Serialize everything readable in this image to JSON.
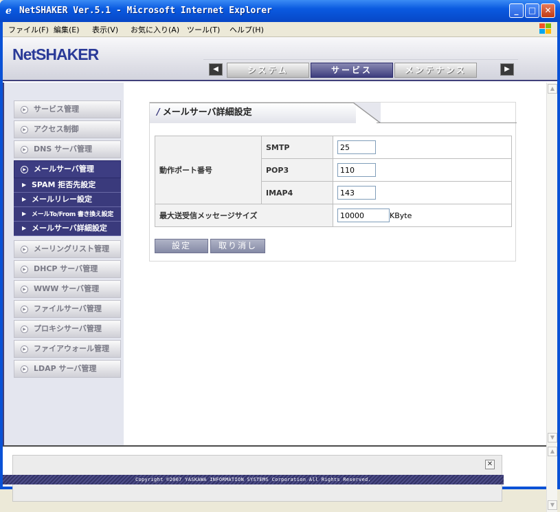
{
  "window": {
    "title": "NetSHAKER Ver.5.1 - Microsoft Internet Explorer"
  },
  "menubar": [
    "ファイル(F)",
    "編集(E)",
    "表示(V)",
    "お気に入り(A)",
    "ツール(T)",
    "ヘルプ(H)"
  ],
  "header": {
    "logo": "NetSHAKER",
    "tabs": [
      {
        "label": "システム",
        "active": false
      },
      {
        "label": "サービス",
        "active": true
      },
      {
        "label": "メンテナンス",
        "active": false
      }
    ]
  },
  "sidebar": {
    "items_top": [
      "サービス管理",
      "アクセス制御",
      "DNS サーバ管理"
    ],
    "active_item": "メールサーバ管理",
    "sub_items": [
      "SPAM 拒否先設定",
      "メールリレー設定",
      "メールTo/From 書き換え設定",
      "メールサーバ詳細設定"
    ],
    "items_bottom": [
      "メーリングリスト管理",
      "DHCP サーバ管理",
      "WWW サーバ管理",
      "ファイルサーバ管理",
      "プロキシサーバ管理",
      "ファイアウォール管理",
      "LDAP サーバ管理"
    ]
  },
  "panel": {
    "title": "メールサーバ詳細設定",
    "port_label": "動作ポート番号",
    "rows": [
      {
        "protocol": "SMTP",
        "value": "25"
      },
      {
        "protocol": "POP3",
        "value": "110"
      },
      {
        "protocol": "IMAP4",
        "value": "143"
      }
    ],
    "max_size_label": "最大送受信メッセージサイズ",
    "max_size_value": "10000",
    "max_size_unit": "KByte",
    "submit_label": "設定",
    "cancel_label": "取り消し"
  },
  "footer": {
    "copyright": "Copyright ©2007 YASKAWA INFORMATION SYSTEMS Corporation All Rights Reserved."
  },
  "colors": {
    "accent": "#3d3d82",
    "titlebar": "#0a5ae0"
  }
}
